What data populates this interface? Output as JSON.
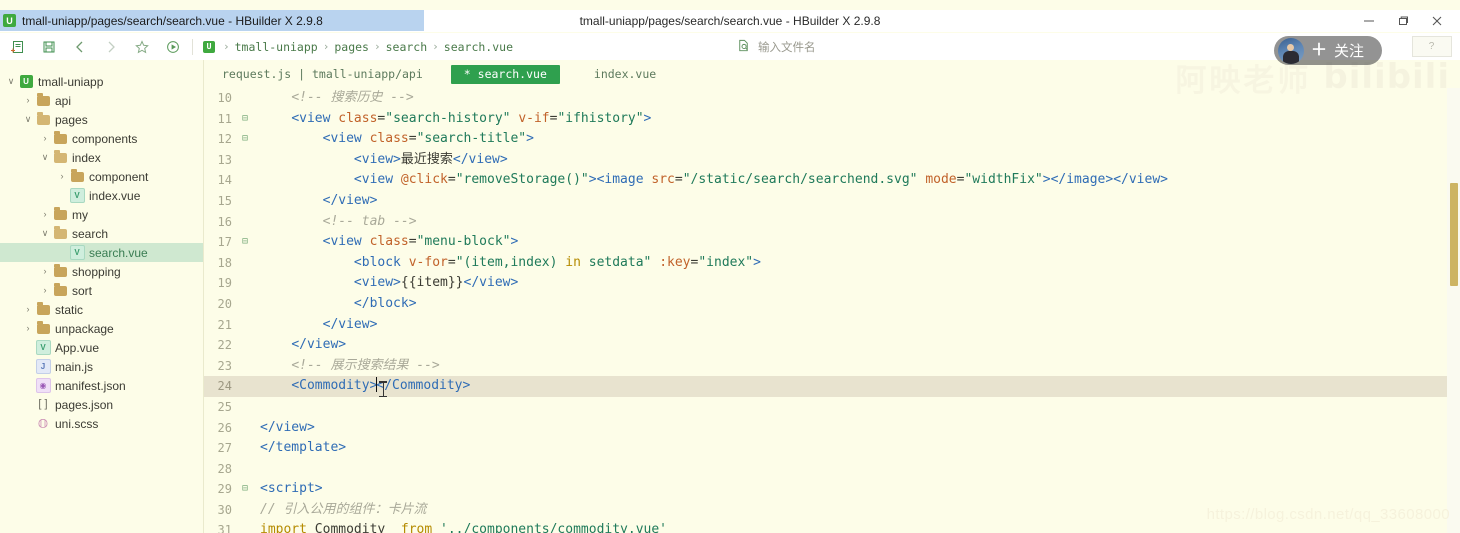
{
  "window": {
    "tab_chip_title": "tmall-uniapp/pages/search/search.vue - HBuilder X 2.9.8",
    "center_title": "tmall-uniapp/pages/search/search.vue - HBuilder X 2.9.8",
    "logo_letter": "U",
    "minimize": "—",
    "maximize": "❐",
    "close": "✕"
  },
  "toolbar": {
    "icons": [
      "new-file-icon",
      "save-icon",
      "back-icon",
      "forward-icon",
      "favorite-icon",
      "run-icon"
    ],
    "crumb_logo_letter": "U",
    "breadcrumb": [
      "tmall-uniapp",
      "pages",
      "search",
      "search.vue"
    ],
    "breadcrumb_separator": "›",
    "file_search_placeholder": "输入文件名",
    "help_label": "?"
  },
  "sidebar": {
    "items": [
      {
        "depth": 0,
        "twisty": "∨",
        "icon": "project-badge",
        "label": "tmall-uniapp",
        "selected": false,
        "type": "project"
      },
      {
        "depth": 1,
        "twisty": "›",
        "icon": "folder-closed-icon",
        "label": "api",
        "selected": false,
        "type": "folder"
      },
      {
        "depth": 1,
        "twisty": "∨",
        "icon": "folder-open-icon",
        "label": "pages",
        "selected": false,
        "type": "folder-open"
      },
      {
        "depth": 2,
        "twisty": "›",
        "icon": "folder-closed-icon",
        "label": "components",
        "selected": false,
        "type": "folder"
      },
      {
        "depth": 2,
        "twisty": "∨",
        "icon": "folder-open-icon",
        "label": "index",
        "selected": false,
        "type": "folder-open"
      },
      {
        "depth": 3,
        "twisty": "›",
        "icon": "folder-closed-icon",
        "label": "component",
        "selected": false,
        "type": "folder"
      },
      {
        "depth": 3,
        "twisty": "",
        "icon": "vue-file-icon",
        "label": "index.vue",
        "selected": false,
        "type": "vue"
      },
      {
        "depth": 2,
        "twisty": "›",
        "icon": "folder-closed-icon",
        "label": "my",
        "selected": false,
        "type": "folder"
      },
      {
        "depth": 2,
        "twisty": "∨",
        "icon": "folder-open-icon",
        "label": "search",
        "selected": false,
        "type": "folder-open"
      },
      {
        "depth": 3,
        "twisty": "",
        "icon": "vue-file-icon",
        "label": "search.vue",
        "selected": true,
        "type": "vue"
      },
      {
        "depth": 2,
        "twisty": "›",
        "icon": "folder-closed-icon",
        "label": "shopping",
        "selected": false,
        "type": "folder"
      },
      {
        "depth": 2,
        "twisty": "›",
        "icon": "folder-closed-icon",
        "label": "sort",
        "selected": false,
        "type": "folder"
      },
      {
        "depth": 1,
        "twisty": "›",
        "icon": "folder-closed-icon",
        "label": "static",
        "selected": false,
        "type": "folder"
      },
      {
        "depth": 1,
        "twisty": "›",
        "icon": "folder-closed-icon",
        "label": "unpackage",
        "selected": false,
        "type": "folder"
      },
      {
        "depth": 1,
        "twisty": "",
        "icon": "vue-file-icon",
        "label": "App.vue",
        "selected": false,
        "type": "vue"
      },
      {
        "depth": 1,
        "twisty": "",
        "icon": "js-file-icon",
        "label": "main.js",
        "selected": false,
        "type": "js"
      },
      {
        "depth": 1,
        "twisty": "",
        "icon": "json-file-icon",
        "label": "manifest.json",
        "selected": false,
        "type": "json"
      },
      {
        "depth": 1,
        "twisty": "",
        "icon": "array-file-icon",
        "label": "pages.json",
        "selected": false,
        "type": "arr"
      },
      {
        "depth": 1,
        "twisty": "",
        "icon": "scss-file-icon",
        "label": "uni.scss",
        "selected": false,
        "type": "scss"
      }
    ]
  },
  "tabs": [
    {
      "label": "request.js | tmall-uniapp/api",
      "active": false,
      "modified": false
    },
    {
      "label": "* search.vue",
      "active": true,
      "modified": true
    },
    {
      "label": "index.vue",
      "active": false,
      "modified": false
    }
  ],
  "editor": {
    "highlighted_line": 24,
    "lines": [
      {
        "n": 10,
        "fold": "",
        "tokens": [
          {
            "t": "    ",
            "c": "pl"
          },
          {
            "t": "<!-- 搜索历史 -->",
            "c": "cmt"
          }
        ]
      },
      {
        "n": 11,
        "fold": "⊟",
        "tokens": [
          {
            "t": "    ",
            "c": "pl"
          },
          {
            "t": "<view ",
            "c": "tg"
          },
          {
            "t": "class",
            "c": "at"
          },
          {
            "t": "=",
            "c": "pl"
          },
          {
            "t": "\"search-history\"",
            "c": "st"
          },
          {
            "t": " ",
            "c": "pl"
          },
          {
            "t": "v-if",
            "c": "at"
          },
          {
            "t": "=",
            "c": "pl"
          },
          {
            "t": "\"ifhistory\"",
            "c": "st"
          },
          {
            "t": ">",
            "c": "tg"
          }
        ]
      },
      {
        "n": 12,
        "fold": "⊟",
        "tokens": [
          {
            "t": "        ",
            "c": "pl"
          },
          {
            "t": "<view ",
            "c": "tg"
          },
          {
            "t": "class",
            "c": "at"
          },
          {
            "t": "=",
            "c": "pl"
          },
          {
            "t": "\"search-title\"",
            "c": "st"
          },
          {
            "t": ">",
            "c": "tg"
          }
        ]
      },
      {
        "n": 13,
        "fold": "",
        "tokens": [
          {
            "t": "            ",
            "c": "pl"
          },
          {
            "t": "<view>",
            "c": "tg"
          },
          {
            "t": "最近搜索",
            "c": "hz"
          },
          {
            "t": "</view>",
            "c": "tg"
          }
        ]
      },
      {
        "n": 14,
        "fold": "",
        "tokens": [
          {
            "t": "            ",
            "c": "pl"
          },
          {
            "t": "<view ",
            "c": "tg"
          },
          {
            "t": "@click",
            "c": "at"
          },
          {
            "t": "=",
            "c": "pl"
          },
          {
            "t": "\"removeStorage()\"",
            "c": "st"
          },
          {
            "t": ">",
            "c": "tg"
          },
          {
            "t": "<image ",
            "c": "tg"
          },
          {
            "t": "src",
            "c": "at"
          },
          {
            "t": "=",
            "c": "pl"
          },
          {
            "t": "\"/static/search/searchend.svg\"",
            "c": "st"
          },
          {
            "t": " ",
            "c": "pl"
          },
          {
            "t": "mode",
            "c": "at"
          },
          {
            "t": "=",
            "c": "pl"
          },
          {
            "t": "\"widthFix\"",
            "c": "st"
          },
          {
            "t": ">",
            "c": "tg"
          },
          {
            "t": "</image>",
            "c": "tg"
          },
          {
            "t": "</view>",
            "c": "tg"
          }
        ]
      },
      {
        "n": 15,
        "fold": "",
        "tokens": [
          {
            "t": "        ",
            "c": "pl"
          },
          {
            "t": "</view>",
            "c": "tg"
          }
        ]
      },
      {
        "n": 16,
        "fold": "",
        "tokens": [
          {
            "t": "        ",
            "c": "pl"
          },
          {
            "t": "<!-- tab -->",
            "c": "cmt"
          }
        ]
      },
      {
        "n": 17,
        "fold": "⊟",
        "tokens": [
          {
            "t": "        ",
            "c": "pl"
          },
          {
            "t": "<view ",
            "c": "tg"
          },
          {
            "t": "class",
            "c": "at"
          },
          {
            "t": "=",
            "c": "pl"
          },
          {
            "t": "\"menu-block\"",
            "c": "st"
          },
          {
            "t": ">",
            "c": "tg"
          }
        ]
      },
      {
        "n": 18,
        "fold": "",
        "tokens": [
          {
            "t": "            ",
            "c": "pl"
          },
          {
            "t": "<block ",
            "c": "tg"
          },
          {
            "t": "v-for",
            "c": "at"
          },
          {
            "t": "=",
            "c": "pl"
          },
          {
            "t": "\"(item,index) ",
            "c": "st"
          },
          {
            "t": "in",
            "c": "kw"
          },
          {
            "t": " setdata\"",
            "c": "st"
          },
          {
            "t": " ",
            "c": "pl"
          },
          {
            "t": ":key",
            "c": "at"
          },
          {
            "t": "=",
            "c": "pl"
          },
          {
            "t": "\"index\"",
            "c": "st"
          },
          {
            "t": ">",
            "c": "tg"
          }
        ]
      },
      {
        "n": 19,
        "fold": "",
        "tokens": [
          {
            "t": "            ",
            "c": "pl"
          },
          {
            "t": "<view>",
            "c": "tg"
          },
          {
            "t": "{{item}}",
            "c": "pl"
          },
          {
            "t": "</view>",
            "c": "tg"
          }
        ]
      },
      {
        "n": 20,
        "fold": "",
        "tokens": [
          {
            "t": "            ",
            "c": "pl"
          },
          {
            "t": "</block>",
            "c": "tg"
          }
        ]
      },
      {
        "n": 21,
        "fold": "",
        "tokens": [
          {
            "t": "        ",
            "c": "pl"
          },
          {
            "t": "</view>",
            "c": "tg"
          }
        ]
      },
      {
        "n": 22,
        "fold": "",
        "tokens": [
          {
            "t": "    ",
            "c": "pl"
          },
          {
            "t": "</view>",
            "c": "tg"
          }
        ]
      },
      {
        "n": 23,
        "fold": "",
        "tokens": [
          {
            "t": "    ",
            "c": "pl"
          },
          {
            "t": "<!-- 展示搜索结果 -->",
            "c": "cmt"
          }
        ]
      },
      {
        "n": 24,
        "fold": "",
        "tokens": [
          {
            "t": "    ",
            "c": "pl"
          },
          {
            "t": "<Commodity>",
            "c": "tg"
          },
          {
            "t": "│",
            "c": "caret"
          },
          {
            "t": "</Commodity>",
            "c": "tg"
          }
        ]
      },
      {
        "n": 25,
        "fold": "",
        "tokens": []
      },
      {
        "n": 26,
        "fold": "",
        "tokens": [
          {
            "t": "</view>",
            "c": "tg"
          }
        ]
      },
      {
        "n": 27,
        "fold": "",
        "tokens": [
          {
            "t": "</template>",
            "c": "tg"
          }
        ]
      },
      {
        "n": 28,
        "fold": "",
        "tokens": []
      },
      {
        "n": 29,
        "fold": "⊟",
        "tokens": [
          {
            "t": "<script>",
            "c": "tg"
          }
        ]
      },
      {
        "n": 30,
        "fold": "",
        "tokens": [
          {
            "t": "// 引入公用的组件：卡片流",
            "c": "cmt"
          }
        ]
      },
      {
        "n": 31,
        "fold": "",
        "tokens": [
          {
            "t": "import",
            "c": "kw"
          },
          {
            "t": " Commodity  ",
            "c": "pl"
          },
          {
            "t": "from",
            "c": "kw"
          },
          {
            "t": " ",
            "c": "pl"
          },
          {
            "t": "'../components/commodity.vue'",
            "c": "st"
          }
        ]
      }
    ]
  },
  "overlays": {
    "follow_plus": "＋",
    "follow_label": "关注",
    "watermark_cn": "阿映老师",
    "watermark_bili": "bilibili",
    "watermark_csdn": "https://blog.csdn.net/qq_33608000"
  }
}
